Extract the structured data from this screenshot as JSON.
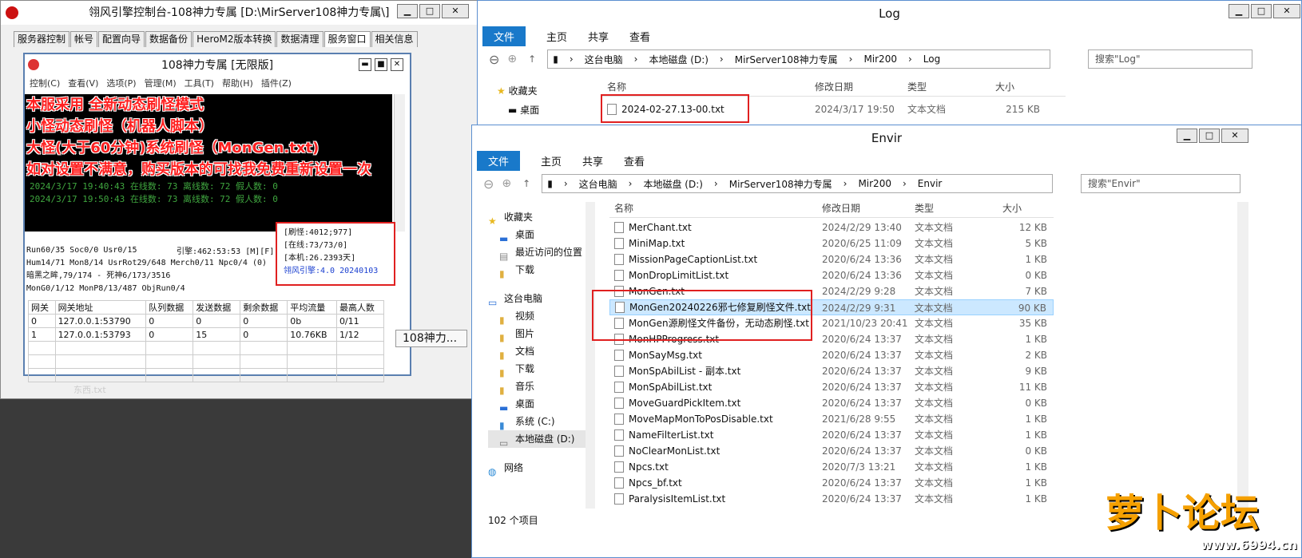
{
  "console": {
    "title": "翎风引擎控制台-108神力专属 [D:\\MirServer108神力专属\\]",
    "tabs": [
      "服务器控制",
      "帐号",
      "配置向导",
      "数据备份",
      "HeroM2版本转换",
      "数据清理",
      "服务窗口",
      "相关信息"
    ],
    "active_tab": 6
  },
  "server": {
    "title": "108神力专属 [无限版]",
    "menu": [
      "控制(C)",
      "查看(V)",
      "选项(P)",
      "管理(M)",
      "工具(T)",
      "帮助(H)",
      "插件(Z)"
    ],
    "overlay_lines": [
      "本服采用 全新动态刷怪模式",
      "小怪动态刷怪（机器人脚本）",
      "大怪(大于60分钟)系统刷怪（MonGen.txt)",
      "如对设置不满意，购买版本的可找我免费重新设置一次"
    ],
    "log_lines": [
      "2024/3/17 19:40:43 在线数: 73 离线数: 72 假人数: 0",
      "2024/3/17 19:50:43 在线数: 73 离线数: 72 假人数: 0"
    ],
    "stats": [
      "Run60/35 Soc0/0 Usr0/15",
      "Hum14/71 Mon8/14 UsrRot29/648 Merch0/11 Npc0/4 (0)",
      "暗黑之眸,79/174 - 死神6/173/3516",
      "MonG0/1/12 MonP8/13/487 ObjRun0/4"
    ],
    "engine_time": "引擎:462:53:53 [M][F]",
    "info": [
      "[刷怪:4012;977]",
      "[在线:73/73/0]",
      "[本机:26.2393天]",
      "翎风引擎:4.0 20240103"
    ],
    "gateway_headers": [
      "网关",
      "网关地址",
      "队列数据",
      "发送数据",
      "剩余数据",
      "平均流量",
      "最高人数"
    ],
    "gateway_rows": [
      [
        "0",
        "127.0.0.1:53790",
        "0",
        "0",
        "0",
        "0b",
        "0/11"
      ],
      [
        "1",
        "127.0.0.1:53793",
        "0",
        "15",
        "0",
        "10.76KB",
        "1/12"
      ]
    ],
    "taskbar_label": "108神力..."
  },
  "bottom_left_text": "东西.txt",
  "log_window": {
    "title": "Log",
    "ribbon": [
      "文件",
      "主页",
      "共享",
      "查看"
    ],
    "path": [
      "这台电脑",
      "本地磁盘 (D:)",
      "MirServer108神力专属",
      "Mir200",
      "Log"
    ],
    "search_placeholder": "搜索\"Log\"",
    "columns": [
      "名称",
      "修改日期",
      "类型",
      "大小"
    ],
    "files": [
      [
        "2024-02-27.13-00.txt",
        "2024/3/17 19:50",
        "文本文档",
        "215 KB"
      ]
    ],
    "nav": [
      "收藏夹",
      "桌面"
    ]
  },
  "envir_window": {
    "title": "Envir",
    "ribbon": [
      "文件",
      "主页",
      "共享",
      "查看"
    ],
    "path": [
      "这台电脑",
      "本地磁盘 (D:)",
      "MirServer108神力专属",
      "Mir200",
      "Envir"
    ],
    "search_placeholder": "搜索\"Envir\"",
    "columns": [
      "名称",
      "修改日期",
      "类型",
      "大小"
    ],
    "nav": [
      "收藏夹",
      "桌面",
      "最近访问的位置",
      "下载",
      "这台电脑",
      "视频",
      "图片",
      "文档",
      "下载",
      "音乐",
      "桌面",
      "系统 (C:)",
      "本地磁盘 (D:)",
      "网络"
    ],
    "files": [
      [
        "MerChant.txt",
        "2024/2/29 13:40",
        "文本文档",
        "12 KB"
      ],
      [
        "MiniMap.txt",
        "2020/6/25 11:09",
        "文本文档",
        "5 KB"
      ],
      [
        "MissionPageCaptionList.txt",
        "2020/6/24 13:36",
        "文本文档",
        "1 KB"
      ],
      [
        "MonDropLimitList.txt",
        "2020/6/24 13:36",
        "文本文档",
        "0 KB"
      ],
      [
        "MonGen.txt",
        "2024/2/29 9:28",
        "文本文档",
        "7 KB"
      ],
      [
        "MonGen20240226邪七修复刷怪文件.txt",
        "2024/2/29 9:31",
        "文本文档",
        "90 KB"
      ],
      [
        "MonGen源刷怪文件备份，无动态刷怪.txt",
        "2021/10/23 20:41",
        "文本文档",
        "35 KB"
      ],
      [
        "MonHPProgress.txt",
        "2020/6/24 13:37",
        "文本文档",
        "1 KB"
      ],
      [
        "MonSayMsg.txt",
        "2020/6/24 13:37",
        "文本文档",
        "2 KB"
      ],
      [
        "MonSpAbilList - 副本.txt",
        "2020/6/24 13:37",
        "文本文档",
        "9 KB"
      ],
      [
        "MonSpAbilList.txt",
        "2020/6/24 13:37",
        "文本文档",
        "11 KB"
      ],
      [
        "MoveGuardPickItem.txt",
        "2020/6/24 13:37",
        "文本文档",
        "0 KB"
      ],
      [
        "MoveMapMonToPosDisable.txt",
        "2021/6/28 9:55",
        "文本文档",
        "1 KB"
      ],
      [
        "NameFilterList.txt",
        "2020/6/24 13:37",
        "文本文档",
        "1 KB"
      ],
      [
        "NoClearMonList.txt",
        "2020/6/24 13:37",
        "文本文档",
        "0 KB"
      ],
      [
        "Npcs.txt",
        "2020/7/3 13:21",
        "文本文档",
        "1 KB"
      ],
      [
        "Npcs_bf.txt",
        "2020/6/24 13:37",
        "文本文档",
        "1 KB"
      ],
      [
        "ParalysisItemList.txt",
        "2020/6/24 13:37",
        "文本文档",
        "1 KB"
      ]
    ],
    "status": "102 个项目"
  },
  "watermark": {
    "name": "萝卜论坛",
    "url": "www.6994.cn"
  }
}
